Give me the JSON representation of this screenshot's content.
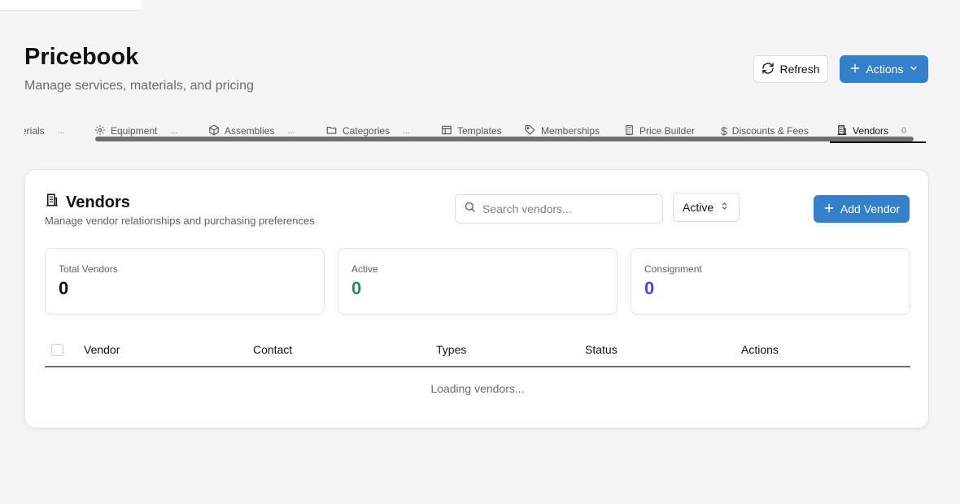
{
  "header": {
    "title": "Pricebook",
    "subtitle": "Manage services, materials, and pricing",
    "refresh_label": "Refresh",
    "actions_label": "Actions"
  },
  "tabs": [
    {
      "label": "erials",
      "count": "..."
    },
    {
      "label": "Equipment",
      "count": "...",
      "icon": "gear-icon"
    },
    {
      "label": "Assemblies",
      "count": "...",
      "icon": "box-icon"
    },
    {
      "label": "Categories",
      "count": "...",
      "icon": "folder-icon"
    },
    {
      "label": "Templates",
      "icon": "layout-icon"
    },
    {
      "label": "Memberships",
      "icon": "tag-icon"
    },
    {
      "label": "Price Builder",
      "icon": "calculator-icon"
    },
    {
      "label": "Discounts & Fees",
      "icon": "dollar-icon"
    },
    {
      "label": "Vendors",
      "count": "0",
      "icon": "building-icon",
      "active": true
    }
  ],
  "vendors": {
    "title": "Vendors",
    "subtitle": "Manage vendor relationships and purchasing preferences",
    "search_placeholder": "Search vendors...",
    "status_filter": "Active",
    "add_label": "Add Vendor",
    "stats": [
      {
        "label": "Total Vendors",
        "value": "0",
        "color": "#111111"
      },
      {
        "label": "Active",
        "value": "0",
        "color": "#2f8a5a"
      },
      {
        "label": "Consignment",
        "value": "0",
        "color": "#5a3fd1"
      }
    ],
    "columns": [
      "Vendor",
      "Contact",
      "Types",
      "Status",
      "Actions"
    ],
    "loading_text": "Loading vendors..."
  },
  "colors": {
    "accent": "#3580c9",
    "active_green": "#2f8a5a",
    "consignment_purple": "#5a3fd1"
  }
}
